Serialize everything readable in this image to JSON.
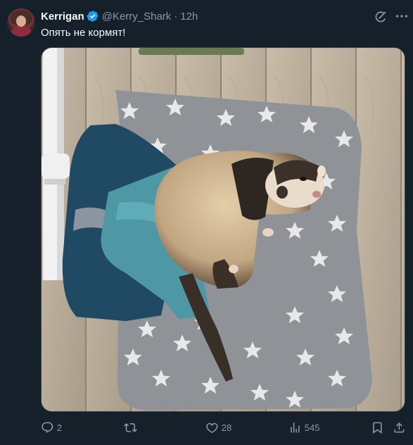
{
  "tweet": {
    "author_name": "Kerrigan",
    "handle": "@Kerry_Shark",
    "separator": "·",
    "time": "12h",
    "text": "Опять не кормят!",
    "verified": true
  },
  "actions": {
    "replies": "2",
    "retweets": "",
    "likes": "28",
    "views": "545"
  },
  "colors": {
    "background": "#15202b",
    "text_primary": "#f7f9f9",
    "text_secondary": "#8b98a5",
    "verified_badge": "#1d9bf0"
  },
  "icons": [
    "avatar",
    "verified-badge-icon",
    "grok-icon",
    "more-icon",
    "reply-icon",
    "retweet-icon",
    "like-icon",
    "views-icon",
    "bookmark-icon",
    "share-icon"
  ]
}
